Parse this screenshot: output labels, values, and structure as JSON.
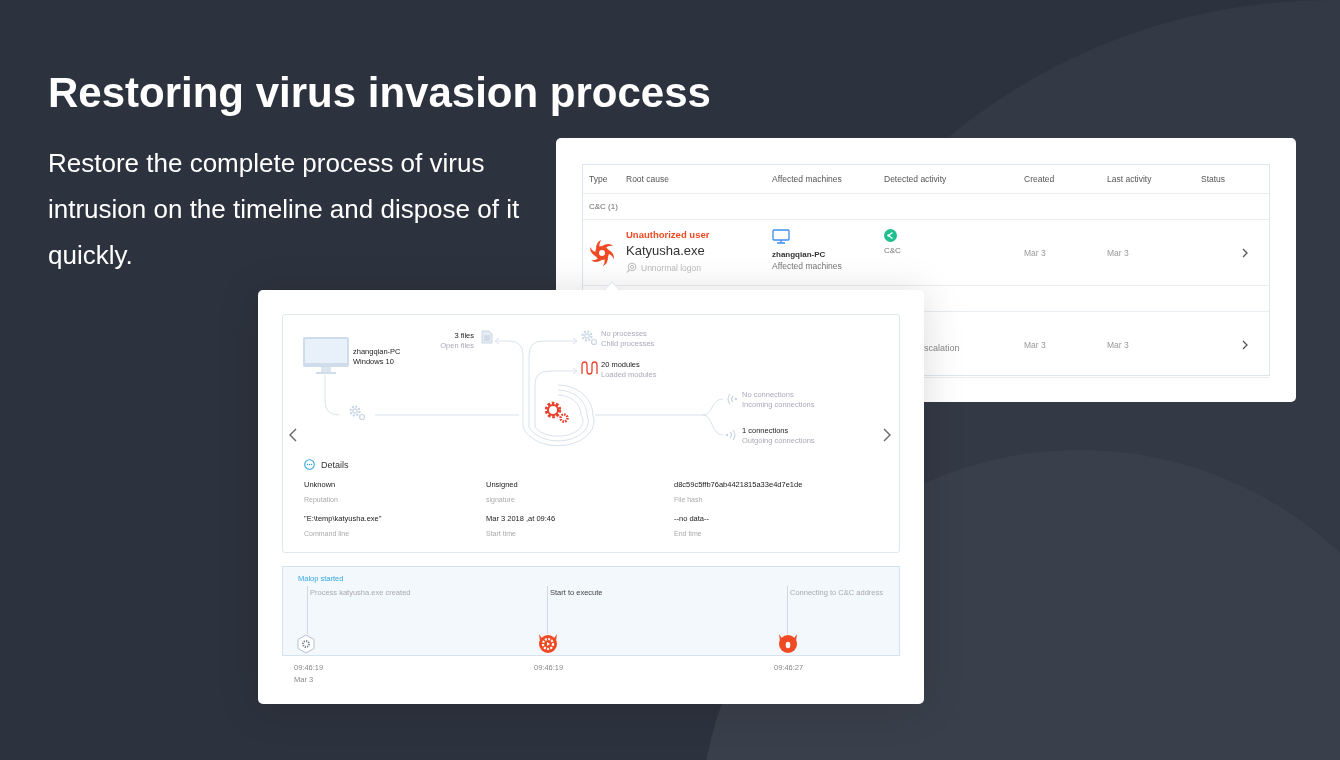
{
  "headline": "Restoring virus invasion process",
  "description": "Restore the complete process of virus intrusion on the timeline and dispose of it quickly.",
  "alert_table": {
    "columns": [
      "Type",
      "Root cause",
      "Affected machines",
      "Detected activity",
      "Created",
      "Last activity",
      "Status"
    ],
    "rows": [
      {
        "kind": "group",
        "label": "C&C (1)"
      },
      {
        "kind": "alert",
        "alert": "Unauthorized user",
        "name": "Katyusha.exe",
        "note": "Unnormal logon",
        "machine": "zhangqian-PC",
        "machine_label": "Affected machines",
        "activity": "C&C",
        "created": "Mar 3",
        "last_activity": "Mar 3"
      },
      {
        "kind": "group"
      },
      {
        "kind": "covered_alert",
        "activity": "scalation",
        "created": "Mar 3",
        "last_activity": "Mar 3"
      }
    ]
  },
  "process_view": {
    "host": {
      "name": "zhangqian-PC",
      "os": "Windows 10"
    },
    "nodes": [
      {
        "kind": "files",
        "value": "3 files",
        "label": "Open files",
        "active": true
      },
      {
        "kind": "processes",
        "value": "No processes",
        "label": "Child processes",
        "active": false
      },
      {
        "kind": "modules",
        "value": "20 modules",
        "label": "Loaded modules",
        "active": true
      },
      {
        "kind": "incoming",
        "value": "No connections",
        "label": "Incoming connections",
        "active": false
      },
      {
        "kind": "outgoing",
        "value": "1 connections",
        "label": "Outgoing connections",
        "active": true
      }
    ],
    "details_title": "Details",
    "details": [
      {
        "value": "Unknown",
        "label": "Reputation"
      },
      {
        "value": "Unsigned",
        "label": "signature"
      },
      {
        "value": "d8c59c5ffb76ab4421815a33e4d7e1de",
        "label": "File hash"
      },
      {
        "value": "\"E:\\temp\\katyusha.exe\"",
        "label": "Command line"
      },
      {
        "value": "Mar 3 2018 ,at 09:46",
        "label": "Start time"
      },
      {
        "value": "--no data--",
        "label": "End time"
      }
    ]
  },
  "timeline": {
    "title": "Malop started",
    "events": [
      {
        "kind": "process",
        "text": "Process katyusha.exe created",
        "time": "09:46:19",
        "date": "Mar 3",
        "active": false
      },
      {
        "kind": "execute",
        "text": "Start to execute",
        "time": "09:46:19",
        "active": true
      },
      {
        "kind": "connect",
        "text": "Connecting to C&C address",
        "time": "09:46:27",
        "active": false
      }
    ]
  }
}
